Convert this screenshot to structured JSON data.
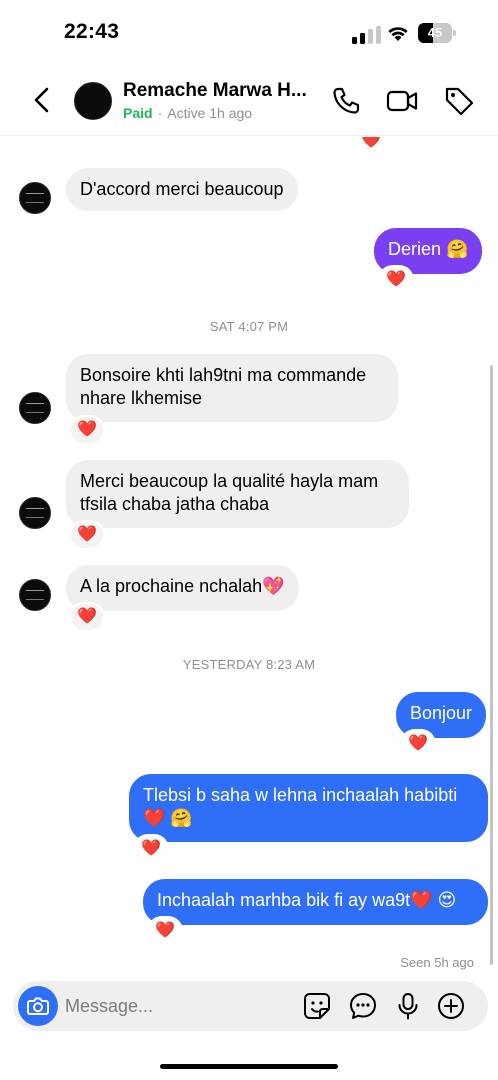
{
  "status_bar": {
    "time": "22:43",
    "battery": "45",
    "battery_level": 0.45
  },
  "header": {
    "name": "Remache Marwa H...",
    "paid": "Paid",
    "separator": "·",
    "active": "Active 1h ago"
  },
  "messages": {
    "m0_reaction": "❤️",
    "m1": "D'accord merci beaucoup",
    "m2": "Derien 🤗",
    "m2_reaction": "❤️",
    "ts1": "SAT 4:07 PM",
    "m3": "Bonsoire khti lah9tni ma commande nhare lkhemise",
    "m3_reaction": "❤️",
    "m4": "Merci beaucoup la qualité hayla mam tfsila chaba jatha chaba",
    "m4_reaction": "❤️",
    "m5": "A la prochaine nchalah💖",
    "m5_reaction": "❤️",
    "ts2": "YESTERDAY 8:23 AM",
    "m6": "Bonjour",
    "m6_reaction": "❤️",
    "m7": "Tlebsi b saha w lehna inchaalah habibti ❤️ 🤗",
    "m7_reaction": "❤️",
    "m8": "Inchaalah marhba bik fi ay wa9t❤️ 😍",
    "m8_reaction": "❤️",
    "seen": "Seen 5h ago"
  },
  "composer": {
    "placeholder": "Message..."
  },
  "colors": {
    "outgoing_purple": "#7b3ff2",
    "outgoing_blue": "#2f6ff7",
    "incoming": "#efefef",
    "paid_green": "#1db954"
  },
  "icons": {
    "back": "chevron-left-icon",
    "call": "phone-icon",
    "video": "video-camera-icon",
    "tag": "tag-icon",
    "camera": "camera-icon",
    "sticker": "sticker-icon",
    "chat": "chat-bubble-icon",
    "mic": "microphone-icon",
    "plus": "plus-circle-icon"
  }
}
